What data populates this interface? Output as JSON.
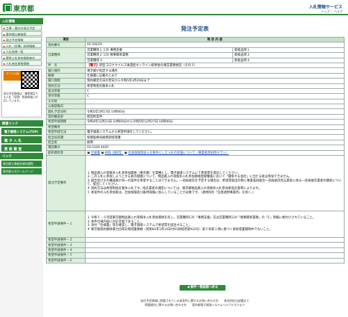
{
  "header": {
    "logo_text": "東京都",
    "system_title": "入札情報サービス",
    "top_links": "トップ ｜ ヘルプ"
  },
  "sidebar": {
    "section1": "入札情報",
    "items": [
      "工事・委託の発注予定",
      "東京都公報検索",
      "発注予定情報",
      "入札（見積）経過情報",
      "入札結果一覧",
      "競争入札参加資格者名",
      "入札参加資格情報"
    ],
    "app_badge": "モバイル版",
    "app_text": "発注予定情報は、携帯電話でも入札（見積）経過情報に対応しています。",
    "section2": "関連リンク",
    "big_items": [
      "電子調達システム(TOP)",
      "電 子 入 札",
      "資 格 審 査"
    ],
    "section3": "リンク",
    "links": [
      "東京都工事総合資料閲覧",
      "東京都公式ホームページ"
    ]
  },
  "page_title": "発注予定表",
  "table": {
    "col_item": "項目",
    "col_content": "項 目 内 容",
    "contract_no_label": "契約番号",
    "contract_no": "05-59229",
    "business_label": "営業種目",
    "business_rows": [
      {
        "left": "営業種目１ 135 事務支援",
        "rank": "取扱品目１"
      },
      {
        "left": "営業種目２ 120 催事関係業務",
        "rank": "取扱品目２"
      },
      {
        "left": "営業種目３",
        "rank": "取扱品目３"
      }
    ],
    "name_label": "件　名",
    "name_tag": "【電子】",
    "name_text": "新型コロナウイルス後遺症オンライン研修会の運営業務委託（その３）",
    "place_label": "履行場所",
    "place": "東京都が指定する場所",
    "summary_label": "概要",
    "summary": "仕様書に記載のとおり",
    "period_label": "履行期間",
    "period": "契約確定の日の翌日から令和5年3月29日まで",
    "method_label": "契約方法",
    "method": "希望制指名競争入札",
    "org_label": "発注等級",
    "org": "C",
    "grade_label": "受付等級",
    "grade": "C",
    "other_label": "その他",
    "public_date_label": "公報登載日",
    "public_date": "",
    "open_date_label": "開札予定日時",
    "open_date": "令和5年1月17日 10時00分",
    "dept_label": "契約審査部",
    "dept": "総契約案件",
    "apply_period_label": "希望申請期間",
    "apply_period": "令和4年12月21日 10時00分から令和5年12月27日 16時00分",
    "remark_label": "希望備考",
    "remark": "",
    "apply_method_label": "希望申請方法",
    "apply_method": "電子調達システムから希望申請をしてください。",
    "office_label": "担当局部課",
    "office": "保健医療局総務部経理課",
    "person_label": "担当者",
    "person": "総務",
    "tel_label": "電話番号",
    "tel": "03-5320-4025",
    "docs_label": "配布資料等",
    "docs": [
      "仕様書",
      "約款【委託】",
      "社会保険等加入を要件とした入札の実施について（事業者周知用チラシ）"
    ],
    "notes_label": "発注予定備考",
    "notes": "１ 物品買入れ等競争入札等参加資格（東京都）を業種とし、電子調達システムにて希望票を提出してください。\n２ この入札に参加しようとする者の関連について、物品買入れ等競争入札参加資格登録審査において「関係する会社」に当たる者は参加できません。\n３ 組合及びその構成員が同一の案件を希望することはできません。一括再委託を予定する場合は、希望票提出の際に事業協同組合一括再委託見込業者に係る一括再委託業者の関係について、提出してください。\n４ 契約方法は希望制指名競争入札です。指名業者の選定については、東京都物品買入れ等競争入札参加者指名基準によります。\n５ 本案件の入札参加者は、社会保険及び雇用保険に加入していることが必要です。（適用除外「任意適用事業所」を除く。）",
    "cond1_label": "希望申請要件－１",
    "cond1": "１ 令和５・６年度東京都物品買入れ等競争入札参加資格を有し、営業種目135「事務支援」又は営業種目120「催事関係業務」の「C」等級に格付けされていること。\n２ 本件仕様内容に対応可能であること。\n３ 添付「仕様書」等を確認し、電子調達システムで希望票を提出すること。\n４ 東京都契約関係暴力団等対策措置要綱（昭和62年1月14日付61財経庶第922号）第５条第１項に基づく排除措置期間中でないこと。",
    "cond_rows": [
      "希望申請要件－２",
      "希望申請要件－３",
      "希望申請要件－４",
      "希望申請要件－５",
      "希望申請要件－６"
    ]
  },
  "back_button": "◀ 案件一覧画面へ戻る",
  "footer": {
    "line1": "発注予定情報に掲載されている各案件に関するお問い合わせ先　　各局所担当部署まで",
    "line2": "掲載操作に関するお問い合わせ先　　東京都電子調達システムヘルプデスクまで"
  }
}
